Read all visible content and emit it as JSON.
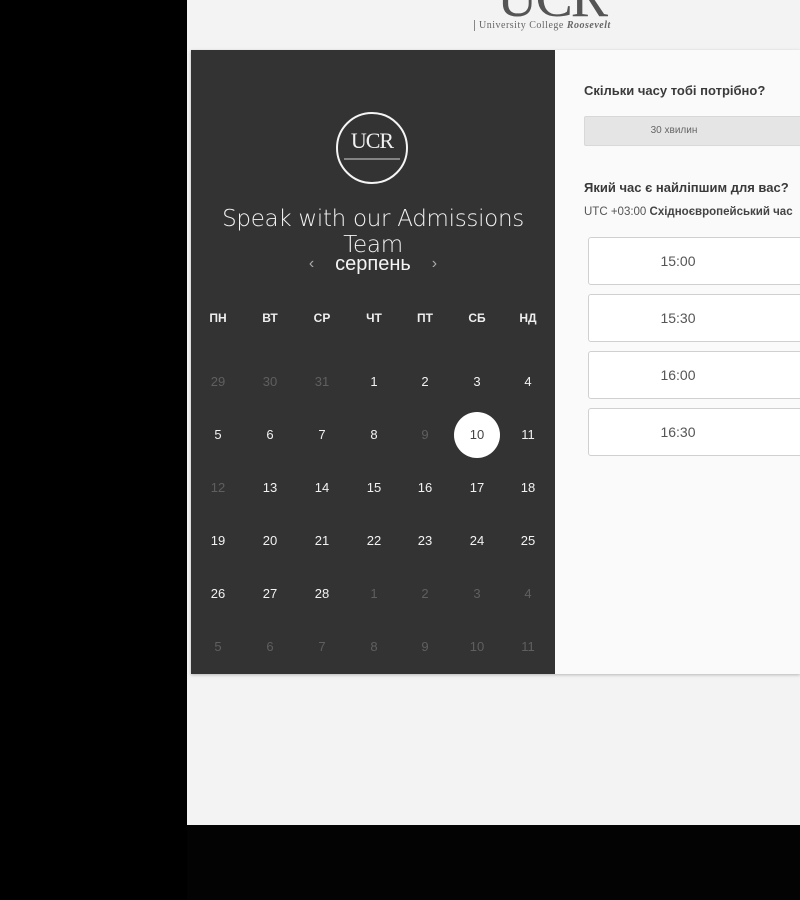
{
  "header": {
    "logo_text": "UCR",
    "logo_subtitle_prefix": "University College",
    "logo_subtitle_name": "Roosevelt"
  },
  "calendar": {
    "logo_text": "UCR",
    "title": "Speak with our Admissions Team",
    "month": "серпень",
    "prev_icon": "‹",
    "next_icon": "›",
    "weekdays": [
      "ПН",
      "ВТ",
      "СР",
      "ЧТ",
      "ПТ",
      "СБ",
      "НД"
    ],
    "weeks": [
      [
        "29",
        "30",
        "31",
        "1",
        "2",
        "3",
        "4"
      ],
      [
        "5",
        "6",
        "7",
        "8",
        "9",
        "10",
        "11"
      ],
      [
        "12",
        "13",
        "14",
        "15",
        "16",
        "17",
        "18"
      ],
      [
        "19",
        "20",
        "21",
        "22",
        "23",
        "24",
        "25"
      ],
      [
        "26",
        "27",
        "28",
        "1",
        "2",
        "3",
        "4"
      ],
      [
        "5",
        "6",
        "7",
        "8",
        "9",
        "10",
        "11"
      ]
    ],
    "muted": [
      [
        true,
        true,
        true,
        false,
        false,
        false,
        false
      ],
      [
        false,
        false,
        false,
        false,
        true,
        false,
        false
      ],
      [
        true,
        false,
        false,
        false,
        false,
        false,
        false
      ],
      [
        false,
        false,
        false,
        false,
        false,
        false,
        false
      ],
      [
        false,
        false,
        false,
        true,
        true,
        true,
        true
      ],
      [
        true,
        true,
        true,
        true,
        true,
        true,
        true
      ]
    ],
    "selected": {
      "week": 1,
      "day": 5
    }
  },
  "booking": {
    "duration_question": "Скільки часу тобі потрібно?",
    "duration_value": "30 хвилин",
    "time_question": "Який час є найліпшим для вас?",
    "timezone_offset": "UTC +03:00",
    "timezone_name": "Східноєвропейський час",
    "slots": [
      "15:00",
      "15:30",
      "16:00",
      "16:30"
    ]
  }
}
